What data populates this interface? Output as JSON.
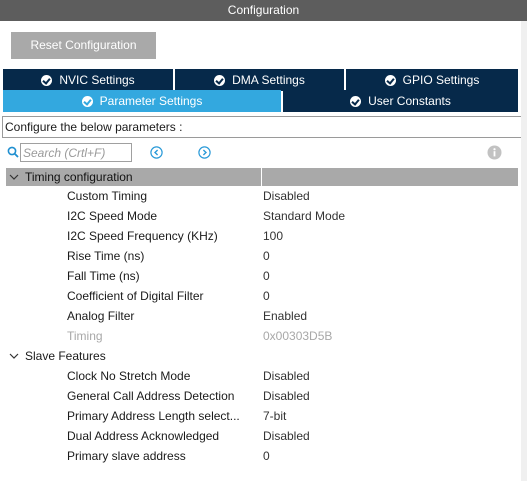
{
  "window": {
    "title": "Configuration"
  },
  "toolbar": {
    "reset_label": "Reset Configuration"
  },
  "tabs_row1": [
    {
      "label": "NVIC Settings",
      "icon": "check-circle-icon",
      "state": "inactive"
    },
    {
      "label": "DMA Settings",
      "icon": "check-circle-icon",
      "state": "inactive"
    },
    {
      "label": "GPIO Settings",
      "icon": "check-circle-icon",
      "state": "inactive"
    }
  ],
  "tabs_row2": [
    {
      "label": "Parameter Settings",
      "icon": "check-circle-icon",
      "state": "active"
    },
    {
      "label": "User Constants",
      "icon": "check-circle-icon",
      "state": "inactive"
    }
  ],
  "configure": {
    "label": "Configure the below parameters :"
  },
  "search": {
    "placeholder": "Search (Crtl+F)"
  },
  "sections": [
    {
      "title": "Timing configuration",
      "expanded": true,
      "rows": [
        {
          "name": "Custom Timing",
          "value": "Disabled",
          "enabled": true
        },
        {
          "name": "I2C Speed Mode",
          "value": "Standard Mode",
          "enabled": true
        },
        {
          "name": "I2C Speed Frequency (KHz)",
          "value": "100",
          "enabled": true
        },
        {
          "name": "Rise Time (ns)",
          "value": "0",
          "enabled": true
        },
        {
          "name": "Fall Time (ns)",
          "value": "0",
          "enabled": true
        },
        {
          "name": "Coefficient of Digital Filter",
          "value": "0",
          "enabled": true
        },
        {
          "name": "Analog Filter",
          "value": "Enabled",
          "enabled": true
        },
        {
          "name": "Timing",
          "value": "0x00303D5B",
          "enabled": false
        }
      ]
    },
    {
      "title": "Slave Features",
      "expanded": true,
      "rows": [
        {
          "name": "Clock No Stretch Mode",
          "value": "Disabled",
          "enabled": true
        },
        {
          "name": "General Call Address Detection",
          "value": "Disabled",
          "enabled": true
        },
        {
          "name": "Primary Address Length select...",
          "value": "7-bit",
          "enabled": true
        },
        {
          "name": "Dual Address Acknowledged",
          "value": "Disabled",
          "enabled": true
        },
        {
          "name": "Primary slave address",
          "value": "0",
          "enabled": true
        }
      ]
    }
  ],
  "colors": {
    "title_bar": "#5d5d5d",
    "tab_dark": "#06294a",
    "tab_active": "#33a8df",
    "section_header": "#a9a9a9",
    "disabled_text": "#a8a8a8"
  }
}
